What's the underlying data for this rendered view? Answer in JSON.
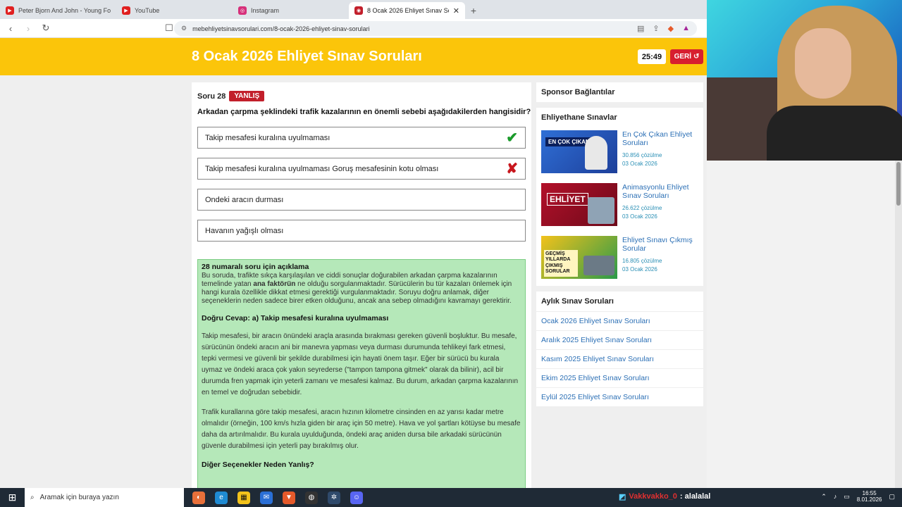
{
  "browser": {
    "tabs": [
      {
        "title": "Peter Bjorn And John - Young Folks",
        "favicon": "youtube-icon",
        "color": "#e02020"
      },
      {
        "title": "YouTube",
        "favicon": "youtube-icon",
        "color": "#e02020"
      },
      {
        "title": "Instagram",
        "favicon": "instagram-icon",
        "color": "#d6307a"
      },
      {
        "title": "8 Ocak 2026 Ehliyet Sınav Sor",
        "favicon": "site-icon",
        "color": "#c21f2b"
      }
    ],
    "url": "mebehliyetsinavsorulari.com/8-ocak-2026-ehliyet-sinav-sorulari"
  },
  "header": {
    "title": "8 Ocak 2026 Ehliyet Sınav Soruları",
    "timer": "25:49",
    "back_label": "GERİ"
  },
  "question": {
    "number_label": "Soru 28",
    "status": "YANLIŞ",
    "text": "Arkadan çarpma şeklindeki trafik kazalarının en önemli sebebi aşağıdakilerden hangisidir?",
    "options": [
      {
        "text": "Takip mesafesi kuralına uyulmaması",
        "mark": "✔",
        "state": "correct"
      },
      {
        "text": "Takip mesafesi kuralına uyulmaması Goruş mesafesinin kotu olması",
        "mark": "✘",
        "state": "wrong"
      },
      {
        "text": "Ondeki aracın durması",
        "mark": "",
        "state": "none"
      },
      {
        "text": "Havanın yağışlı olması",
        "mark": "",
        "state": "none"
      }
    ]
  },
  "explanation": {
    "title": "28 numaralı soru için açıklama",
    "intro_a": "Bu soruda, trafikte sıkça karşılaşılan ve ciddi sonuçlar doğurabilen arkadan çarpma kazalarının temelinde yatan ",
    "intro_bold": "ana faktörün",
    "intro_b": " ne olduğu sorgulanmaktadır. Sürücülerin bu tür kazaları önlemek için hangi kurala özellikle dikkat etmesi gerektiği vurgulanmaktadır. Soruyu doğru anlamak, diğer seçeneklerin neden sadece birer etken olduğunu, ancak ana sebep olmadığını kavramayı gerektirir.",
    "answer": "Doğru Cevap: a) Takip mesafesi kuralına uyulmaması",
    "p1": "Takip mesafesi, bir aracın önündeki araçla arasında bırakması gereken güvenli boşluktur. Bu mesafe, sürücünün öndeki aracın ani bir manevra yapması veya durması durumunda tehlikeyi fark etmesi, tepki vermesi ve güvenli bir şekilde durabilmesi için hayati önem taşır. Eğer bir sürücü bu kurala uymaz ve öndeki araca çok yakın seyrederse (\"tampon tampona gitmek\" olarak da bilinir), acil bir durumda fren yapmak için yeterli zamanı ve mesafesi kalmaz. Bu durum, arkadan çarpma kazalarının en temel ve doğrudan sebebidir.",
    "p2": "Trafik kurallarına göre takip mesafesi, aracın hızının kilometre cinsinden en az yarısı kadar metre olmalıdır (örneğin, 100 km/s hızla giden bir araç için 50 metre). Hava ve yol şartları kötüyse bu mesafe daha da artırılmalıdır. Bu kurala uyulduğunda, öndeki araç aniden dursa bile arkadaki sürücünün güvenle durabilmesi için yeterli pay bırakılmış olur.",
    "other_title": "Diğer Seçenekler Neden Yanlış?"
  },
  "sidebar": {
    "sponsor_title": "Sponsor Bağlantılar",
    "exams_title": "Ehliyethane Sınavlar",
    "exams": [
      {
        "title": "En Çok Çıkan Ehliyet Soruları",
        "count": "30.856 çözülme",
        "date": "03 Ocak 2026",
        "thumb_text": "EN ÇOK ÇIKAN"
      },
      {
        "title": "Animasyonlu Ehliyet Sınav Soruları",
        "count": "26.622 çözülme",
        "date": "03 Ocak 2026",
        "thumb_text": "EHLİYET"
      },
      {
        "title": "Ehliyet Sınavı Çıkmış Sorular",
        "count": "16.805 çözülme",
        "date": "03 Ocak 2026",
        "thumb_text": "GEÇMİŞ YILLARDA ÇIKMIŞ SORULAR"
      }
    ],
    "monthly_title": "Aylık Sınav Soruları",
    "monthly": [
      "Ocak 2026 Ehliyet Sınav Soruları",
      "Aralık 2025 Ehliyet Sınav Soruları",
      "Kasım 2025 Ehliyet Sınav Soruları",
      "Ekim 2025 Ehliyet Sınav Soruları",
      "Eylül 2025 Ehliyet Sınav Soruları"
    ]
  },
  "taskbar": {
    "search_placeholder": "Aramak için buraya yazın",
    "chat_user": "Vakkvakko_0",
    "chat_msg": ": alalalal",
    "time": "16:55",
    "date": "8.01.2026"
  }
}
